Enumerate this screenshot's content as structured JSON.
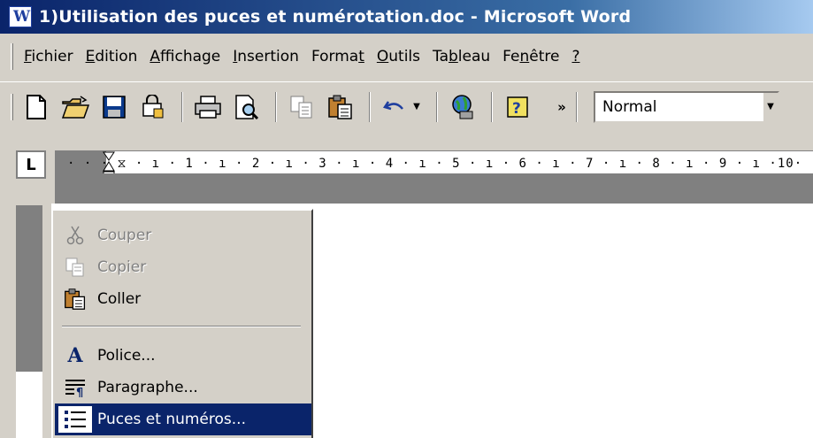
{
  "window": {
    "title": "1)Utilisation des puces et numérotation.doc - Microsoft Word",
    "app_icon": "word-icon"
  },
  "menubar": {
    "items": [
      {
        "label": "Fichier",
        "accel": "F"
      },
      {
        "label": "Edition",
        "accel": "E"
      },
      {
        "label": "Affichage",
        "accel": "A"
      },
      {
        "label": "Insertion",
        "accel": "I"
      },
      {
        "label": "Format",
        "accel": "t"
      },
      {
        "label": "Outils",
        "accel": "O"
      },
      {
        "label": "Tableau",
        "accel": "b"
      },
      {
        "label": "Fenêtre",
        "accel": "n"
      },
      {
        "label": "?",
        "accel": "?"
      }
    ]
  },
  "toolbar": {
    "buttons": [
      "new-document-icon",
      "open-folder-icon",
      "save-icon",
      "permission-icon",
      "print-icon",
      "print-preview-icon",
      "copy-icon",
      "paste-icon",
      "undo-icon",
      "web-globe-icon",
      "help-icon"
    ],
    "overflow": "»",
    "style_value": "Normal"
  },
  "ruler": {
    "tab_button": "L",
    "labels": "· · · ⧖ · ı · 1 · ı · 2 · ı · 3 · ı · 4 · ı · 5 · ı · 6 · ı · 7 · ı · 8 · ı · 9 · ı ·10·"
  },
  "context_menu": {
    "items": [
      {
        "label": "Couper",
        "icon": "scissors-icon",
        "enabled": false
      },
      {
        "label": "Copier",
        "icon": "copy-icon",
        "enabled": false
      },
      {
        "label": "Coller",
        "icon": "paste-icon",
        "enabled": true
      },
      {
        "label": "Police...",
        "icon": "font-icon",
        "enabled": true
      },
      {
        "label": "Paragraphe...",
        "icon": "paragraph-icon",
        "enabled": true
      },
      {
        "label": "Puces et numéros...",
        "icon": "bullets-numbering-icon",
        "enabled": true,
        "selected": true
      }
    ]
  },
  "colors": {
    "title_bar": "#0a246a",
    "face": "#d4d0c8",
    "highlight": "#0a246a"
  }
}
